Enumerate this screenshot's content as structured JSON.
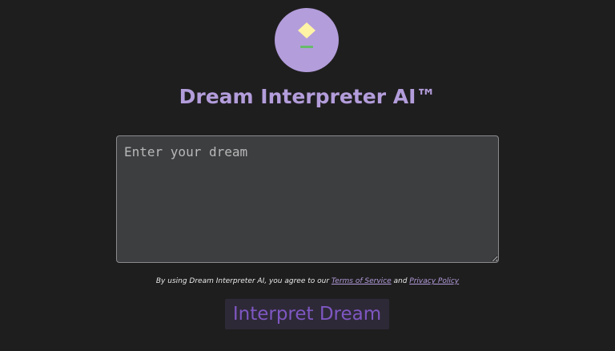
{
  "app": {
    "title": "Dream Interpreter AI™",
    "logo_icon": "dream-lamp-icon"
  },
  "input": {
    "value": "",
    "placeholder": "Enter your dream"
  },
  "disclaimer": {
    "prefix": "By using Dream Interpreter AI, you agree to our ",
    "terms_label": "Terms of Service",
    "conjunction": " and ",
    "privacy_label": "Privacy Policy"
  },
  "actions": {
    "interpret_label": "Interpret Dream"
  },
  "colors": {
    "background": "#1f1e1f",
    "accent": "#b39ddb",
    "button_text": "#7e57c2",
    "button_bg": "#2e2937",
    "input_bg": "#3d3e40"
  }
}
